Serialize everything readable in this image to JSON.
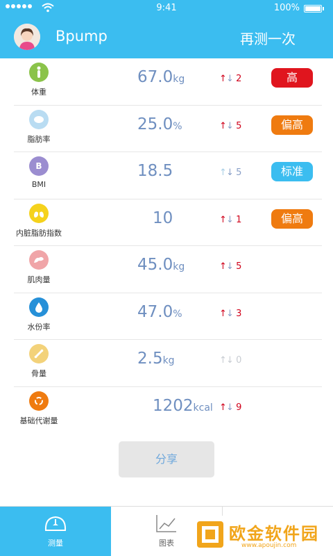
{
  "status_bar": {
    "time": "9:41",
    "battery": "100%"
  },
  "header": {
    "title": "Bpump",
    "retest_label": "再测一次"
  },
  "metrics": [
    {
      "label": "体重",
      "icon": "person-icon",
      "icon_color": "#8bc34a",
      "icon_glyph": "",
      "value": "67.0",
      "unit": "kg",
      "up_color": "#d0021b",
      "down_color": "#8aa0c8",
      "count": "2",
      "count_color": "#d0021b",
      "badge": "高",
      "badge_color": "#e0151e"
    },
    {
      "label": "脂肪率",
      "icon": "fat-icon",
      "icon_color": "#b9dcf2",
      "icon_glyph": "",
      "value": "25.0",
      "unit": "%",
      "up_color": "#d0021b",
      "down_color": "#8aa0c8",
      "count": "5",
      "count_color": "#d0021b",
      "badge": "偏高",
      "badge_color": "#ef7b10"
    },
    {
      "label": "BMI",
      "icon": "bmi-icon",
      "icon_color": "#9b8dd0",
      "icon_glyph": "B",
      "value": "18.5",
      "unit": "",
      "up_color": "#a9cfe6",
      "down_color": "#8aa0c8",
      "count": "5",
      "count_color": "#8aa0c8",
      "badge": "标准",
      "badge_color": "#3bbdf0"
    },
    {
      "label": "内脏脂肪指数",
      "icon": "lungs-icon",
      "icon_color": "#f5d21c",
      "icon_glyph": "",
      "value": "10",
      "unit": "",
      "up_color": "#d0021b",
      "down_color": "#8aa0c8",
      "count": "1",
      "count_color": "#d0021b",
      "badge": "偏高",
      "badge_color": "#ef7b10"
    },
    {
      "label": "肌肉量",
      "icon": "muscle-icon",
      "icon_color": "#f0a5a8",
      "icon_glyph": "",
      "value": "45.0",
      "unit": "kg",
      "up_color": "#d0021b",
      "down_color": "#8aa0c8",
      "count": "5",
      "count_color": "#d0021b",
      "badge": "",
      "badge_color": ""
    },
    {
      "label": "水份率",
      "icon": "water-drop-icon",
      "icon_color": "#2690d8",
      "icon_glyph": "",
      "value": "47.0",
      "unit": "%",
      "up_color": "#d0021b",
      "down_color": "#8aa0c8",
      "count": "3",
      "count_color": "#d0021b",
      "badge": "",
      "badge_color": ""
    },
    {
      "label": "骨量",
      "icon": "bone-icon",
      "icon_color": "#f3d27a",
      "icon_glyph": "",
      "value": "2.5",
      "unit": "kg",
      "up_color": "#c8ccd2",
      "down_color": "#c8ccd2",
      "count": "0",
      "count_color": "#c8ccd2",
      "badge": "",
      "badge_color": ""
    },
    {
      "label": "基础代谢量",
      "icon": "recycle-icon",
      "icon_color": "#ef7b10",
      "icon_glyph": "",
      "value": "1202",
      "unit": "kcal",
      "up_color": "#d0021b",
      "down_color": "#8aa0c8",
      "count": "9",
      "count_color": "#d0021b",
      "badge": "",
      "badge_color": ""
    }
  ],
  "share_label": "分享",
  "tabs": [
    {
      "label": "测量",
      "icon": "scale-icon",
      "active": true
    },
    {
      "label": "图表",
      "icon": "chart-icon",
      "active": false
    },
    {
      "label": "",
      "icon": "user-icon",
      "active": false
    }
  ],
  "watermark": {
    "main": "欧金软件园",
    "sub": "www.apoujin.com"
  },
  "colors": {
    "accent": "#3bbdf0",
    "value": "#6f8fc0"
  }
}
